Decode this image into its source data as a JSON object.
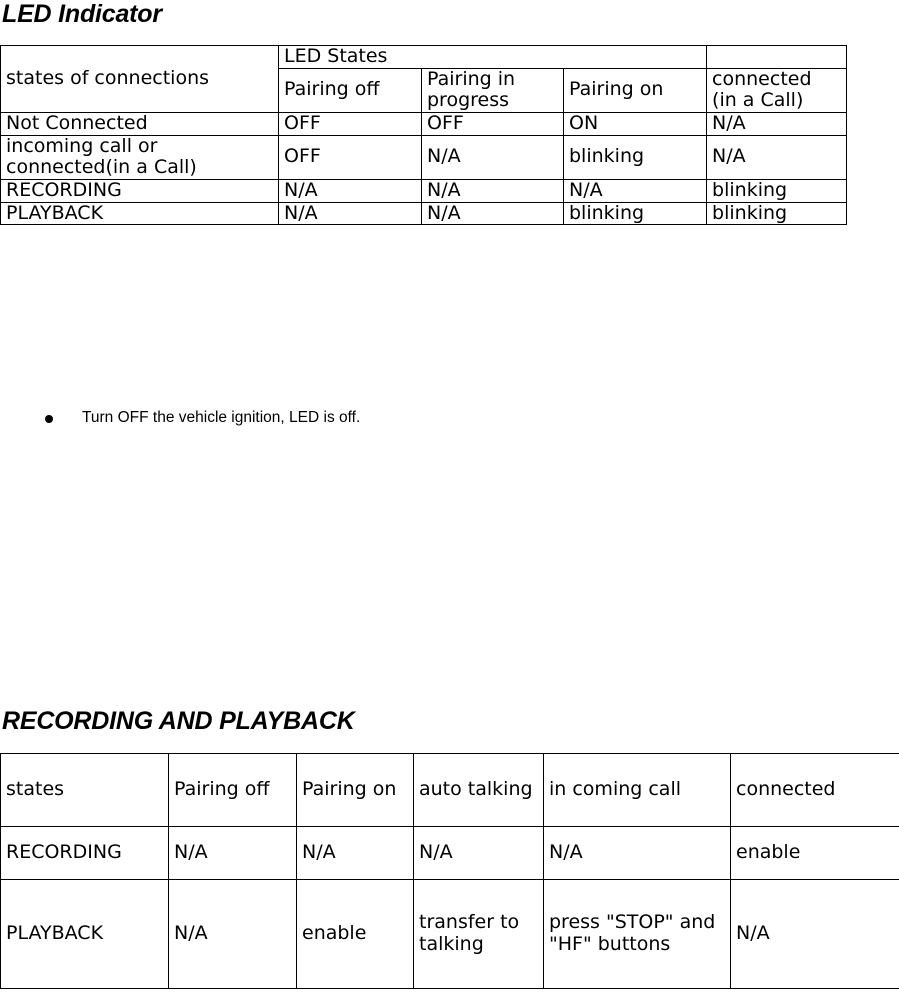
{
  "sections": [
    {
      "heading": "LED Indicator",
      "table": {
        "header": {
          "row_label": "states of connections",
          "group_label": "LED States",
          "columns": [
            "Pairing off",
            "Pairing in progress",
            "Pairing on",
            " connected (in a Call)"
          ],
          "corner_blank": ""
        },
        "rows": [
          {
            "state": "Not Connected",
            "values": [
              "OFF",
              "OFF",
              "ON",
              "N/A"
            ]
          },
          {
            "state": "incoming call or connected(in a Call)",
            "values": [
              "OFF",
              "N/A",
              "blinking",
              "N/A"
            ]
          },
          {
            "state": "RECORDING",
            "values": [
              "N/A",
              "N/A",
              "N/A",
              "blinking"
            ]
          },
          {
            "state": "PLAYBACK",
            "values": [
              "N/A",
              "N/A",
              "blinking",
              "blinking"
            ]
          }
        ]
      },
      "notes": [
        "Turn OFF the vehicle ignition, LED is off."
      ]
    },
    {
      "heading": "RECORDING AND PLAYBACK",
      "table": {
        "header": [
          "states",
          "Pairing off",
          "Pairing on",
          "auto talking",
          "in coming call",
          "connected"
        ],
        "rows": [
          {
            "state": "RECORDING",
            "values": [
              "N/A",
              "N/A",
              "N/A",
              "N/A",
              "enable"
            ]
          },
          {
            "state": "PLAYBACK",
            "values": [
              "N/A",
              "enable",
              "transfer to talking",
              "press \"STOP\" and \"HF\" buttons",
              "N/A"
            ]
          }
        ]
      }
    }
  ],
  "colors": {
    "text": "#000000",
    "background": "#ffffff",
    "table_border": "#000000"
  }
}
